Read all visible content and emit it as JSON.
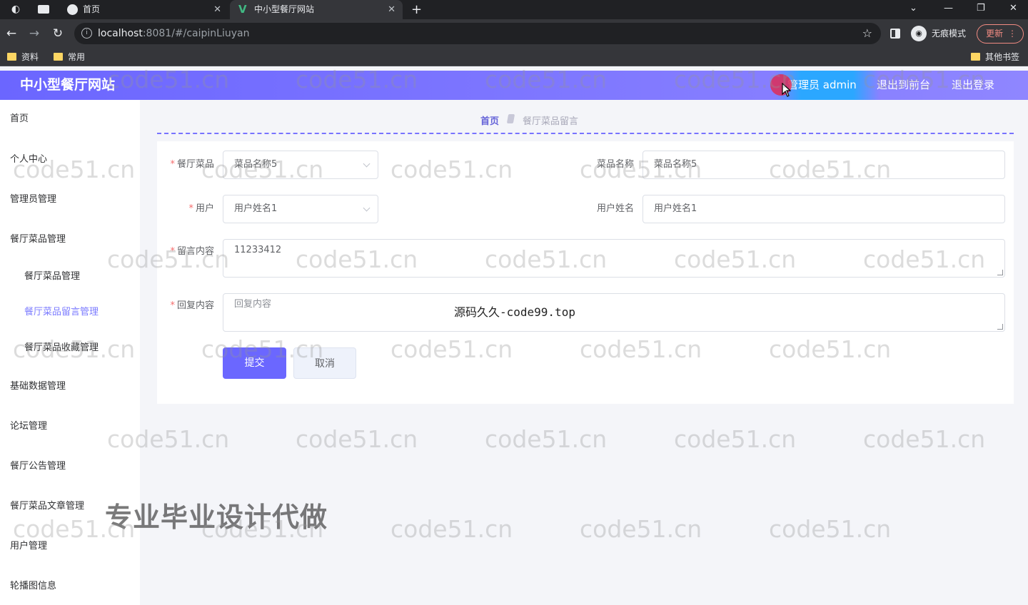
{
  "browser": {
    "tabs": [
      {
        "label": "首页"
      },
      {
        "label": "中小型餐厅网站"
      }
    ],
    "url_host": "localhost",
    "url_rest": ":8081/#/caipinLiuyan",
    "incognito_label": "无痕模式",
    "update_label": "更新",
    "bookmarks": [
      "资料",
      "常用"
    ],
    "other_bookmarks": "其他书签"
  },
  "header": {
    "brand": "中小型餐厅网站",
    "admin_label": "管理员 admin",
    "front_link": "退出到前台",
    "logout_link": "退出登录"
  },
  "sidebar": {
    "items": [
      {
        "label": "首页"
      },
      {
        "label": "个人中心"
      },
      {
        "label": "管理员管理"
      },
      {
        "label": "餐厅菜品管理"
      },
      {
        "label": "餐厅菜品管理"
      },
      {
        "label": "餐厅菜品留言管理"
      },
      {
        "label": "餐厅菜品收藏管理"
      },
      {
        "label": "基础数据管理"
      },
      {
        "label": "论坛管理"
      },
      {
        "label": "餐厅公告管理"
      },
      {
        "label": "餐厅菜品文章管理"
      },
      {
        "label": "用户管理"
      },
      {
        "label": "轮播图信息"
      }
    ]
  },
  "breadcrumb": {
    "home": "首页",
    "current": "餐厅菜品留言"
  },
  "form": {
    "dish_label": "餐厅菜品",
    "dish_value": "菜品名称5",
    "dish_name_label": "菜品名称",
    "dish_name_value": "菜品名称5",
    "user_label": "用户",
    "user_value": "用户姓名1",
    "user_name_label": "用户姓名",
    "user_name_value": "用户姓名1",
    "message_label": "留言内容",
    "message_value": "11233412",
    "reply_label": "回复内容",
    "reply_placeholder": "回复内容",
    "submit_label": "提交",
    "cancel_label": "取消"
  },
  "overlay_text": "源码久久-code99.top",
  "promo_text": "专业毕业设计代做",
  "watermark_text": "code51.cn"
}
